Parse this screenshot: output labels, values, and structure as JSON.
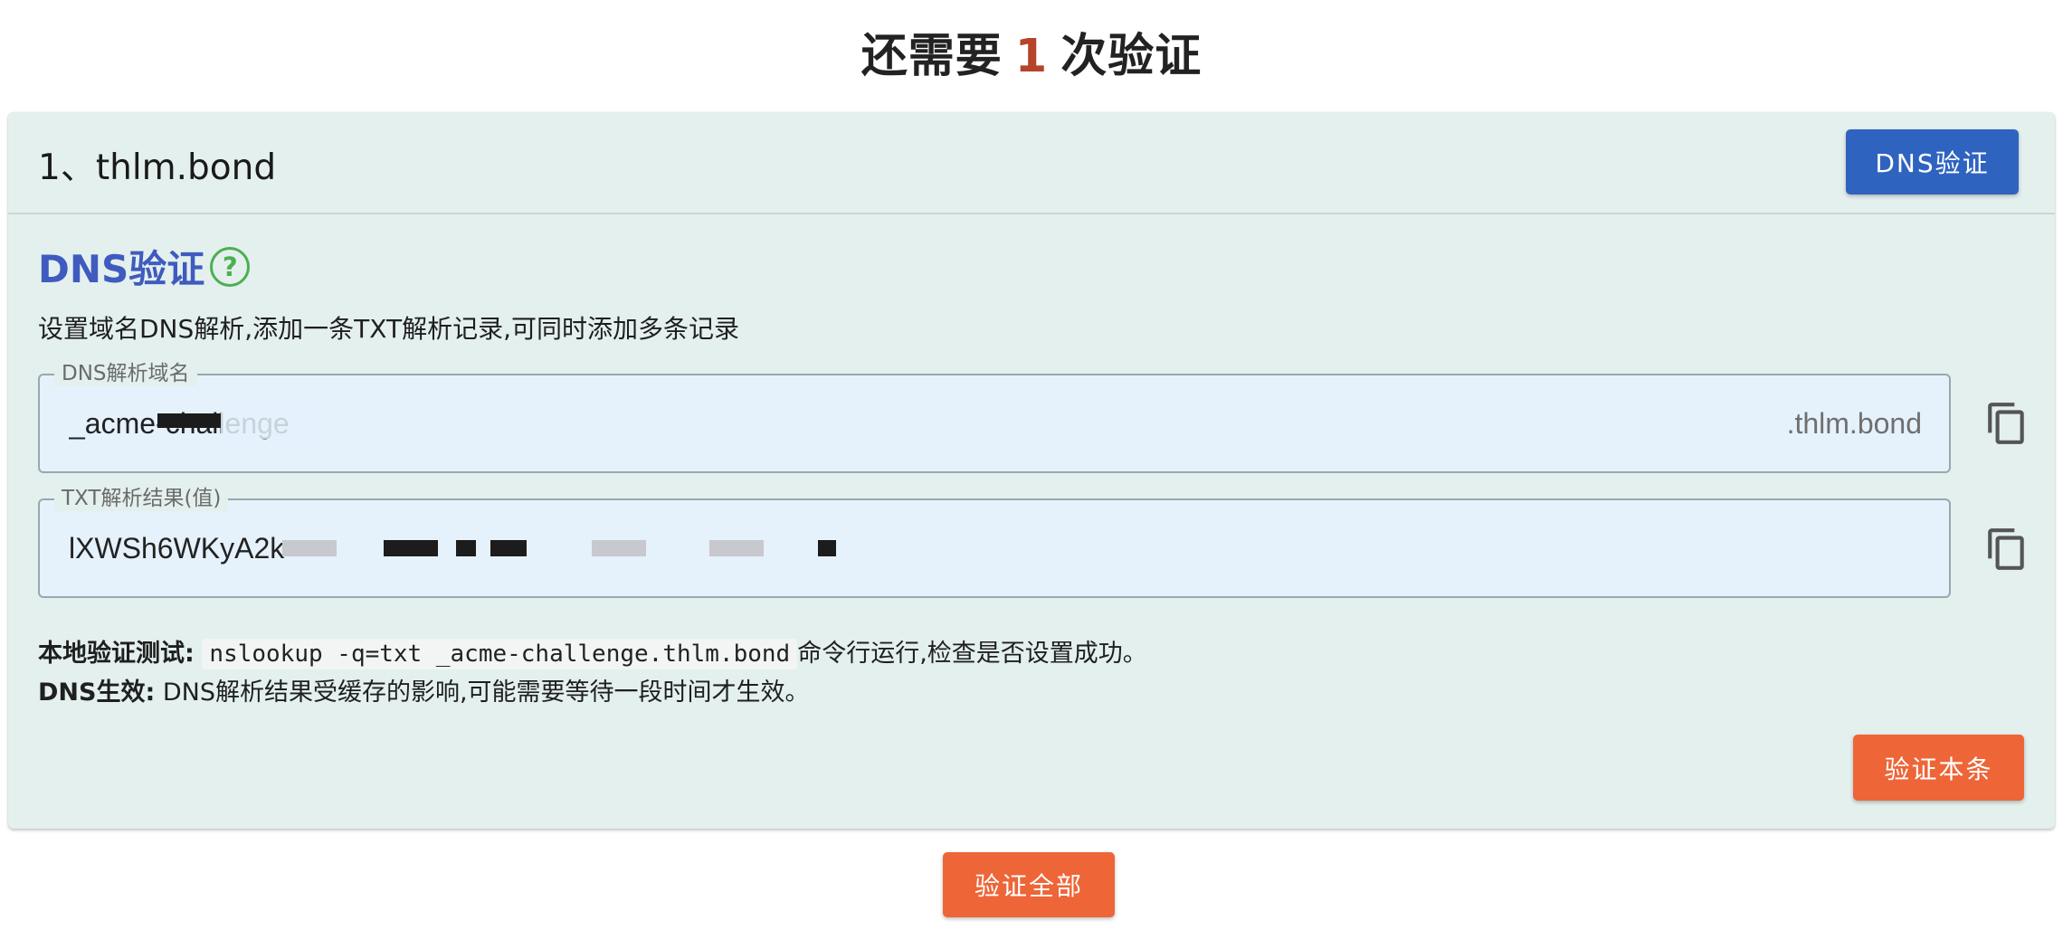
{
  "header": {
    "title_prefix": "还需要",
    "remaining_count": "1",
    "title_suffix": "次验证"
  },
  "card": {
    "domain_title": "1、thlm.bond",
    "dns_verify_button": "DNS验证",
    "section_title": "DNS验证",
    "help_icon": "?",
    "description": "设置域名DNS解析,添加一条TXT解析记录,可同时添加多条记录",
    "fields": [
      {
        "legend": "DNS解析域名",
        "value": "_acme-challenge",
        "suffix": ".thlm.bond"
      },
      {
        "legend": "TXT解析结果(值)",
        "value": "lXWSh6WKyA2k",
        "suffix": ""
      }
    ],
    "local_test": {
      "label": "本地验证测试:",
      "command": "nslookup -q=txt _acme-challenge.thlm.bond",
      "after": "命令行运行,检查是否设置成功。"
    },
    "dns_effect": {
      "label": "DNS生效:",
      "text": " DNS解析结果受缓存的影响,可能需要等待一段时间才生效。"
    },
    "verify_one_button": "验证本条"
  },
  "footer": {
    "verify_all_button": "验证全部"
  },
  "colors": {
    "card_bg": "#e3f0ee",
    "field_bg": "#e5f1fb",
    "primary_blue": "#2f63c0",
    "accent_orange": "#ee6538",
    "section_title": "#3f5bbf",
    "help_green": "#4caf50",
    "count_red": "#b5442a"
  },
  "icons": [
    "help-circle-icon",
    "copy-icon"
  ]
}
